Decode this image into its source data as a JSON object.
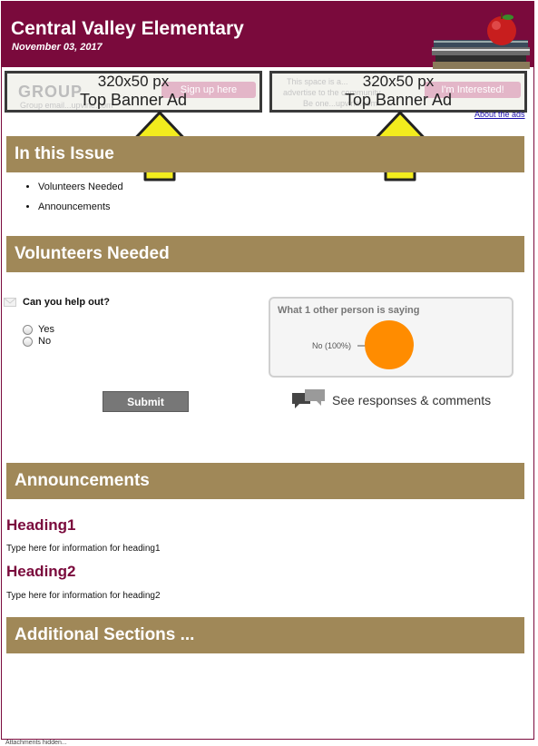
{
  "header": {
    "title": "Central Valley Elementary",
    "date": "November 03, 2017"
  },
  "ads": [
    {
      "size": "320x50 px",
      "label": "Top Banner Ad",
      "bg_brand": "GROUP",
      "bg_button": "Sign up here",
      "bg_line": "Group email...upvine.com"
    },
    {
      "size": "320x50 px",
      "label": "Top Banner Ad",
      "bg_line1": "This space is a...",
      "bg_line2": "advertise to the community",
      "bg_line3": "Be one...upvine.com",
      "bg_button": "I'm Interested!"
    }
  ],
  "about_ads": "About the ads",
  "sections": {
    "in_this_issue": "In this Issue",
    "volunteers": "Volunteers Needed",
    "announcements": "Announcements",
    "additional": "Additional Sections ..."
  },
  "toc": [
    "Volunteers Needed",
    "Announcements"
  ],
  "poll": {
    "question": "Can you help out?",
    "options": [
      "Yes",
      "No"
    ],
    "submit": "Submit",
    "results_title": "What 1 other person is saying",
    "results_legend": "No (100%)",
    "see_responses": "See responses & comments"
  },
  "chart_data": {
    "type": "pie",
    "categories": [
      "No"
    ],
    "values": [
      100
    ]
  },
  "announcements": [
    {
      "heading": "Heading1",
      "text": "Type here for information for heading1"
    },
    {
      "heading": "Heading2",
      "text": "Type here for information for heading2"
    }
  ],
  "footnote": "Attachments hidden...",
  "colors": {
    "brand": "#7a0a3c",
    "section_bar": "#a08858",
    "pie": "#ff8c00",
    "arrow": "#f2ec1d"
  }
}
